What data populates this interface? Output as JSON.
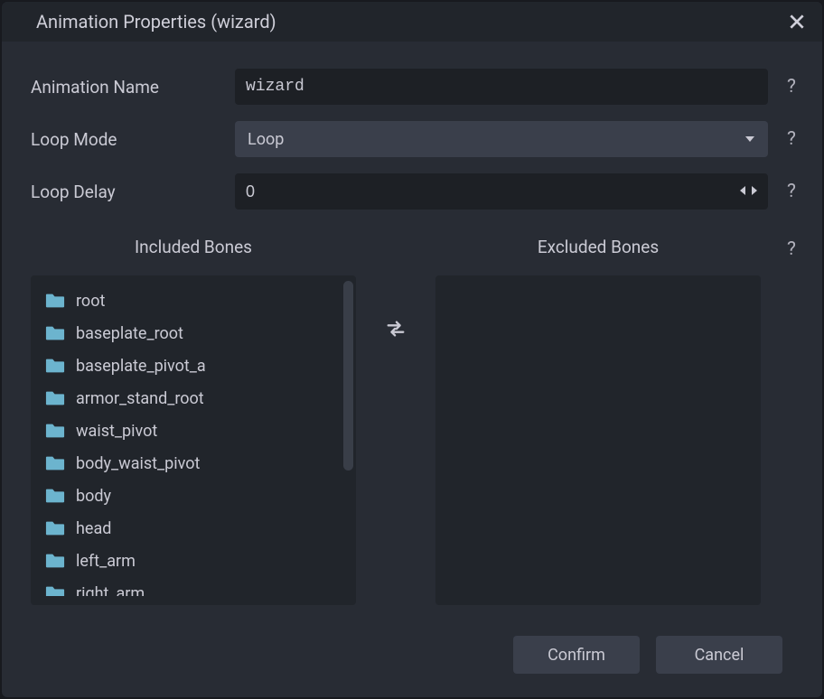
{
  "title": "Animation Properties (wizard)",
  "form": {
    "name_label": "Animation Name",
    "name_value": "wizard",
    "loopmode_label": "Loop Mode",
    "loopmode_value": "Loop",
    "loopdelay_label": "Loop Delay",
    "loopdelay_value": "0"
  },
  "bones": {
    "included_header": "Included Bones",
    "excluded_header": "Excluded Bones",
    "included": [
      "root",
      "baseplate_root",
      "baseplate_pivot_a",
      "armor_stand_root",
      "waist_pivot",
      "body_waist_pivot",
      "body",
      "head",
      "left_arm",
      "right_arm"
    ],
    "excluded": []
  },
  "footer": {
    "confirm": "Confirm",
    "cancel": "Cancel"
  },
  "help_glyph": "?"
}
